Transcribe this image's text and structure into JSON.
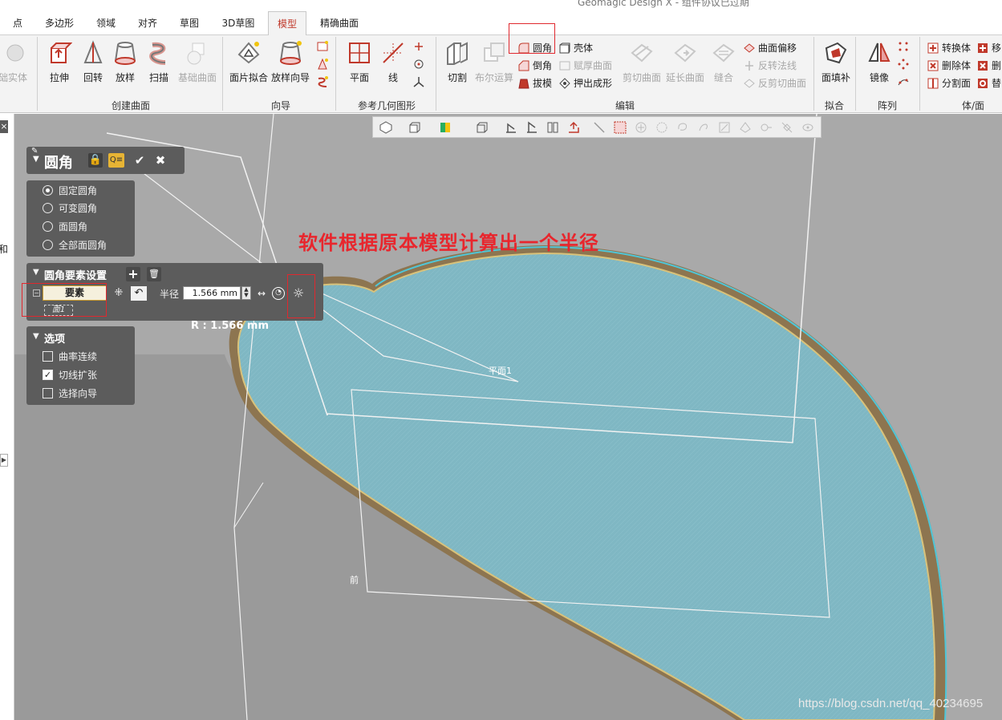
{
  "window": {
    "title": "Geomagic Design X - 组件协议已过期"
  },
  "menu_tabs": [
    {
      "label": "点"
    },
    {
      "label": "多边形"
    },
    {
      "label": "领域"
    },
    {
      "label": "对齐"
    },
    {
      "label": "草图"
    },
    {
      "label": "3D草图"
    },
    {
      "label": "模型"
    },
    {
      "label": "精确曲面"
    }
  ],
  "active_tab": "模型",
  "ribbon": {
    "partial_left": {
      "label": "基础实体"
    },
    "create_surface": {
      "label": "创建曲面",
      "buttons": [
        "拉伸",
        "回转",
        "放样",
        "扫描",
        "基础曲面"
      ]
    },
    "guide": {
      "label": "向导",
      "buttons": [
        "面片拟合",
        "放样向导"
      ]
    },
    "ref_geometry": {
      "label": "参考几何图形",
      "buttons": [
        "平面",
        "线"
      ]
    },
    "edit": {
      "label": "编辑",
      "big_buttons": [
        "切割",
        "布尔运算"
      ],
      "col1": [
        "圆角",
        "倒角",
        "拔模"
      ],
      "col2": [
        "壳体",
        "赋厚曲面",
        "押出成形"
      ],
      "big_buttons2": [
        "剪切曲面",
        "延长曲面",
        "缝合"
      ],
      "col3": [
        "曲面偏移",
        "反转法线",
        "反剪切曲面"
      ]
    },
    "fit": {
      "label": "拟合",
      "buttons": [
        "面填补"
      ]
    },
    "array": {
      "label": "阵列",
      "buttons": [
        "镜像"
      ]
    },
    "body_face": {
      "label": "体/面",
      "col1": [
        "转换体",
        "删除体",
        "分割面"
      ],
      "col2": [
        "移",
        "删",
        "替"
      ]
    }
  },
  "left_strip": {
    "text1": "和"
  },
  "fillet_panel": {
    "title": "圆角",
    "modes": [
      "固定圆角",
      "可变圆角",
      "面圆角",
      "全部面圆角"
    ],
    "selected_mode": "固定圆角"
  },
  "element_settings": {
    "title": "圆角要素设置",
    "element_label": "要素",
    "radius_label": "半径",
    "radius_value": "1.566 mm",
    "face_item": "面1"
  },
  "options": {
    "title": "选项",
    "items": [
      {
        "label": "曲率连续",
        "checked": false
      },
      {
        "label": "切线扩张",
        "checked": true
      },
      {
        "label": "选择向导",
        "checked": false
      }
    ]
  },
  "viewport": {
    "radius_readout": "R :  1.566 mm",
    "plane_label": "平面1",
    "front_label": "前",
    "annotation": "软件根据原本模型计算出一个半径",
    "watermark": "https://blog.csdn.net/qq_40234695"
  },
  "colors": {
    "annotation_red": "#e8262d",
    "model_fill": "#7fb7c3",
    "model_edge": "#b0904a",
    "viewport_bg": "#a9a9a9",
    "panel_bg": "#5c5c5c"
  }
}
